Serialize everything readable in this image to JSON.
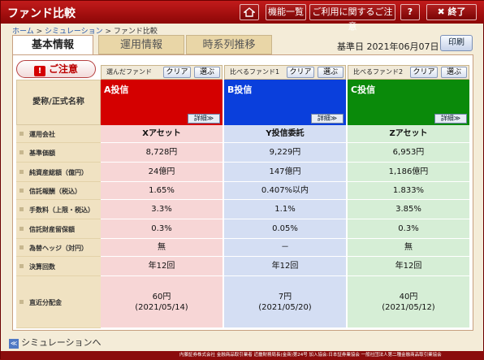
{
  "app": {
    "title": "ファンド比較",
    "function_list": "機能一覧",
    "notice": "ご利用に関するご注意",
    "help": "?",
    "close": "✖ 終了"
  },
  "breadcrumb": {
    "home": "ホーム",
    "sep1": " > ",
    "simulation": "シミュレーション",
    "sep2": " > ",
    "current": "ファンド比較"
  },
  "tabs": [
    "基本情報",
    "運用情報",
    "時系列推移"
  ],
  "base_date": "基準日 2021年06月07日",
  "print_label": "印刷",
  "caution_label": "ご注意",
  "name_header": "愛称/正式名称",
  "clear_label": "クリア",
  "choose_label": "選ぶ",
  "detail_label": "詳細≫",
  "funds": [
    {
      "slot": "選んだファンド",
      "name": "A投信",
      "color": "#d40000"
    },
    {
      "slot": "比べるファンド1",
      "name": "B投信",
      "color": "#0a3fdc"
    },
    {
      "slot": "比べるファンド2",
      "name": "C投信",
      "color": "#0a8a0a"
    }
  ],
  "rows": [
    {
      "label": "運用会社",
      "values": [
        "Xアセット",
        "Y投信委託",
        "Zアセット"
      ]
    },
    {
      "label": "基準価額",
      "values": [
        "8,728円",
        "9,229円",
        "6,953円"
      ]
    },
    {
      "label": "純資産総額（億円）",
      "values": [
        "24億円",
        "147億円",
        "1,186億円"
      ]
    },
    {
      "label": "信託報酬（税込）",
      "values": [
        "1.65%",
        "0.407%以内",
        "1.833%"
      ]
    },
    {
      "label": "手数料（上限・税込）",
      "values": [
        "3.3%",
        "1.1%",
        "3.85%"
      ]
    },
    {
      "label": "信託財産留保額",
      "values": [
        "0.3%",
        "0.05%",
        "0.3%"
      ]
    },
    {
      "label": "為替ヘッジ（対円）",
      "values": [
        "無",
        "－",
        "無"
      ]
    },
    {
      "label": "決算回数",
      "values": [
        "年12回",
        "年12回",
        "年12回"
      ]
    },
    {
      "label": "直近分配金",
      "values": [
        "60円",
        "7円",
        "40円"
      ],
      "dates": [
        "(2021/05/14)",
        "(2021/05/20)",
        "(2021/05/12)"
      ]
    }
  ],
  "back_label": "シミュレーションへ",
  "footer_text": "内藤証券株式会社 金融商品取引業者 近畿財務局長(金商)第24号 加入協会:日本証券業協会 一般社団法人第二種金融商品取引業協会"
}
